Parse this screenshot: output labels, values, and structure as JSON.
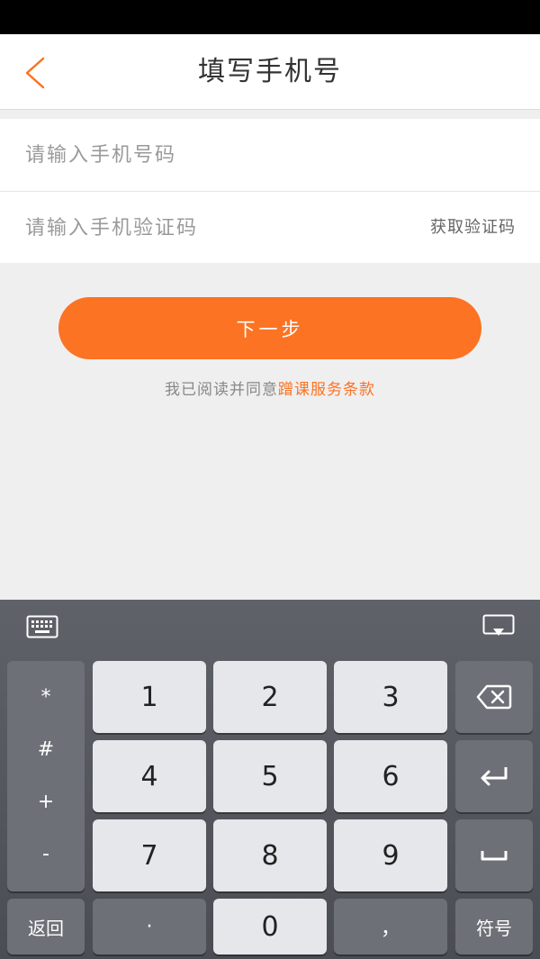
{
  "header": {
    "title": "填写手机号",
    "back_icon": "chevron-left-icon"
  },
  "form": {
    "phone_placeholder": "请输入手机号码",
    "code_placeholder": "请输入手机验证码",
    "get_code_label": "获取验证码"
  },
  "next_button": "下一步",
  "agreement": {
    "prefix": "我已阅读并同意",
    "link": "蹭课服务条款"
  },
  "keyboard": {
    "symbols": [
      "*",
      "#",
      "+",
      "-"
    ],
    "digits": [
      "1",
      "2",
      "3",
      "4",
      "5",
      "6",
      "7",
      "8",
      "9"
    ],
    "back_label": "返回",
    "dot": "·",
    "zero": "0",
    "comma": "，",
    "symbols_label": "符号"
  },
  "colors": {
    "accent": "#fb7323",
    "status_bar": "#000000",
    "keyboard": "#55585e"
  }
}
